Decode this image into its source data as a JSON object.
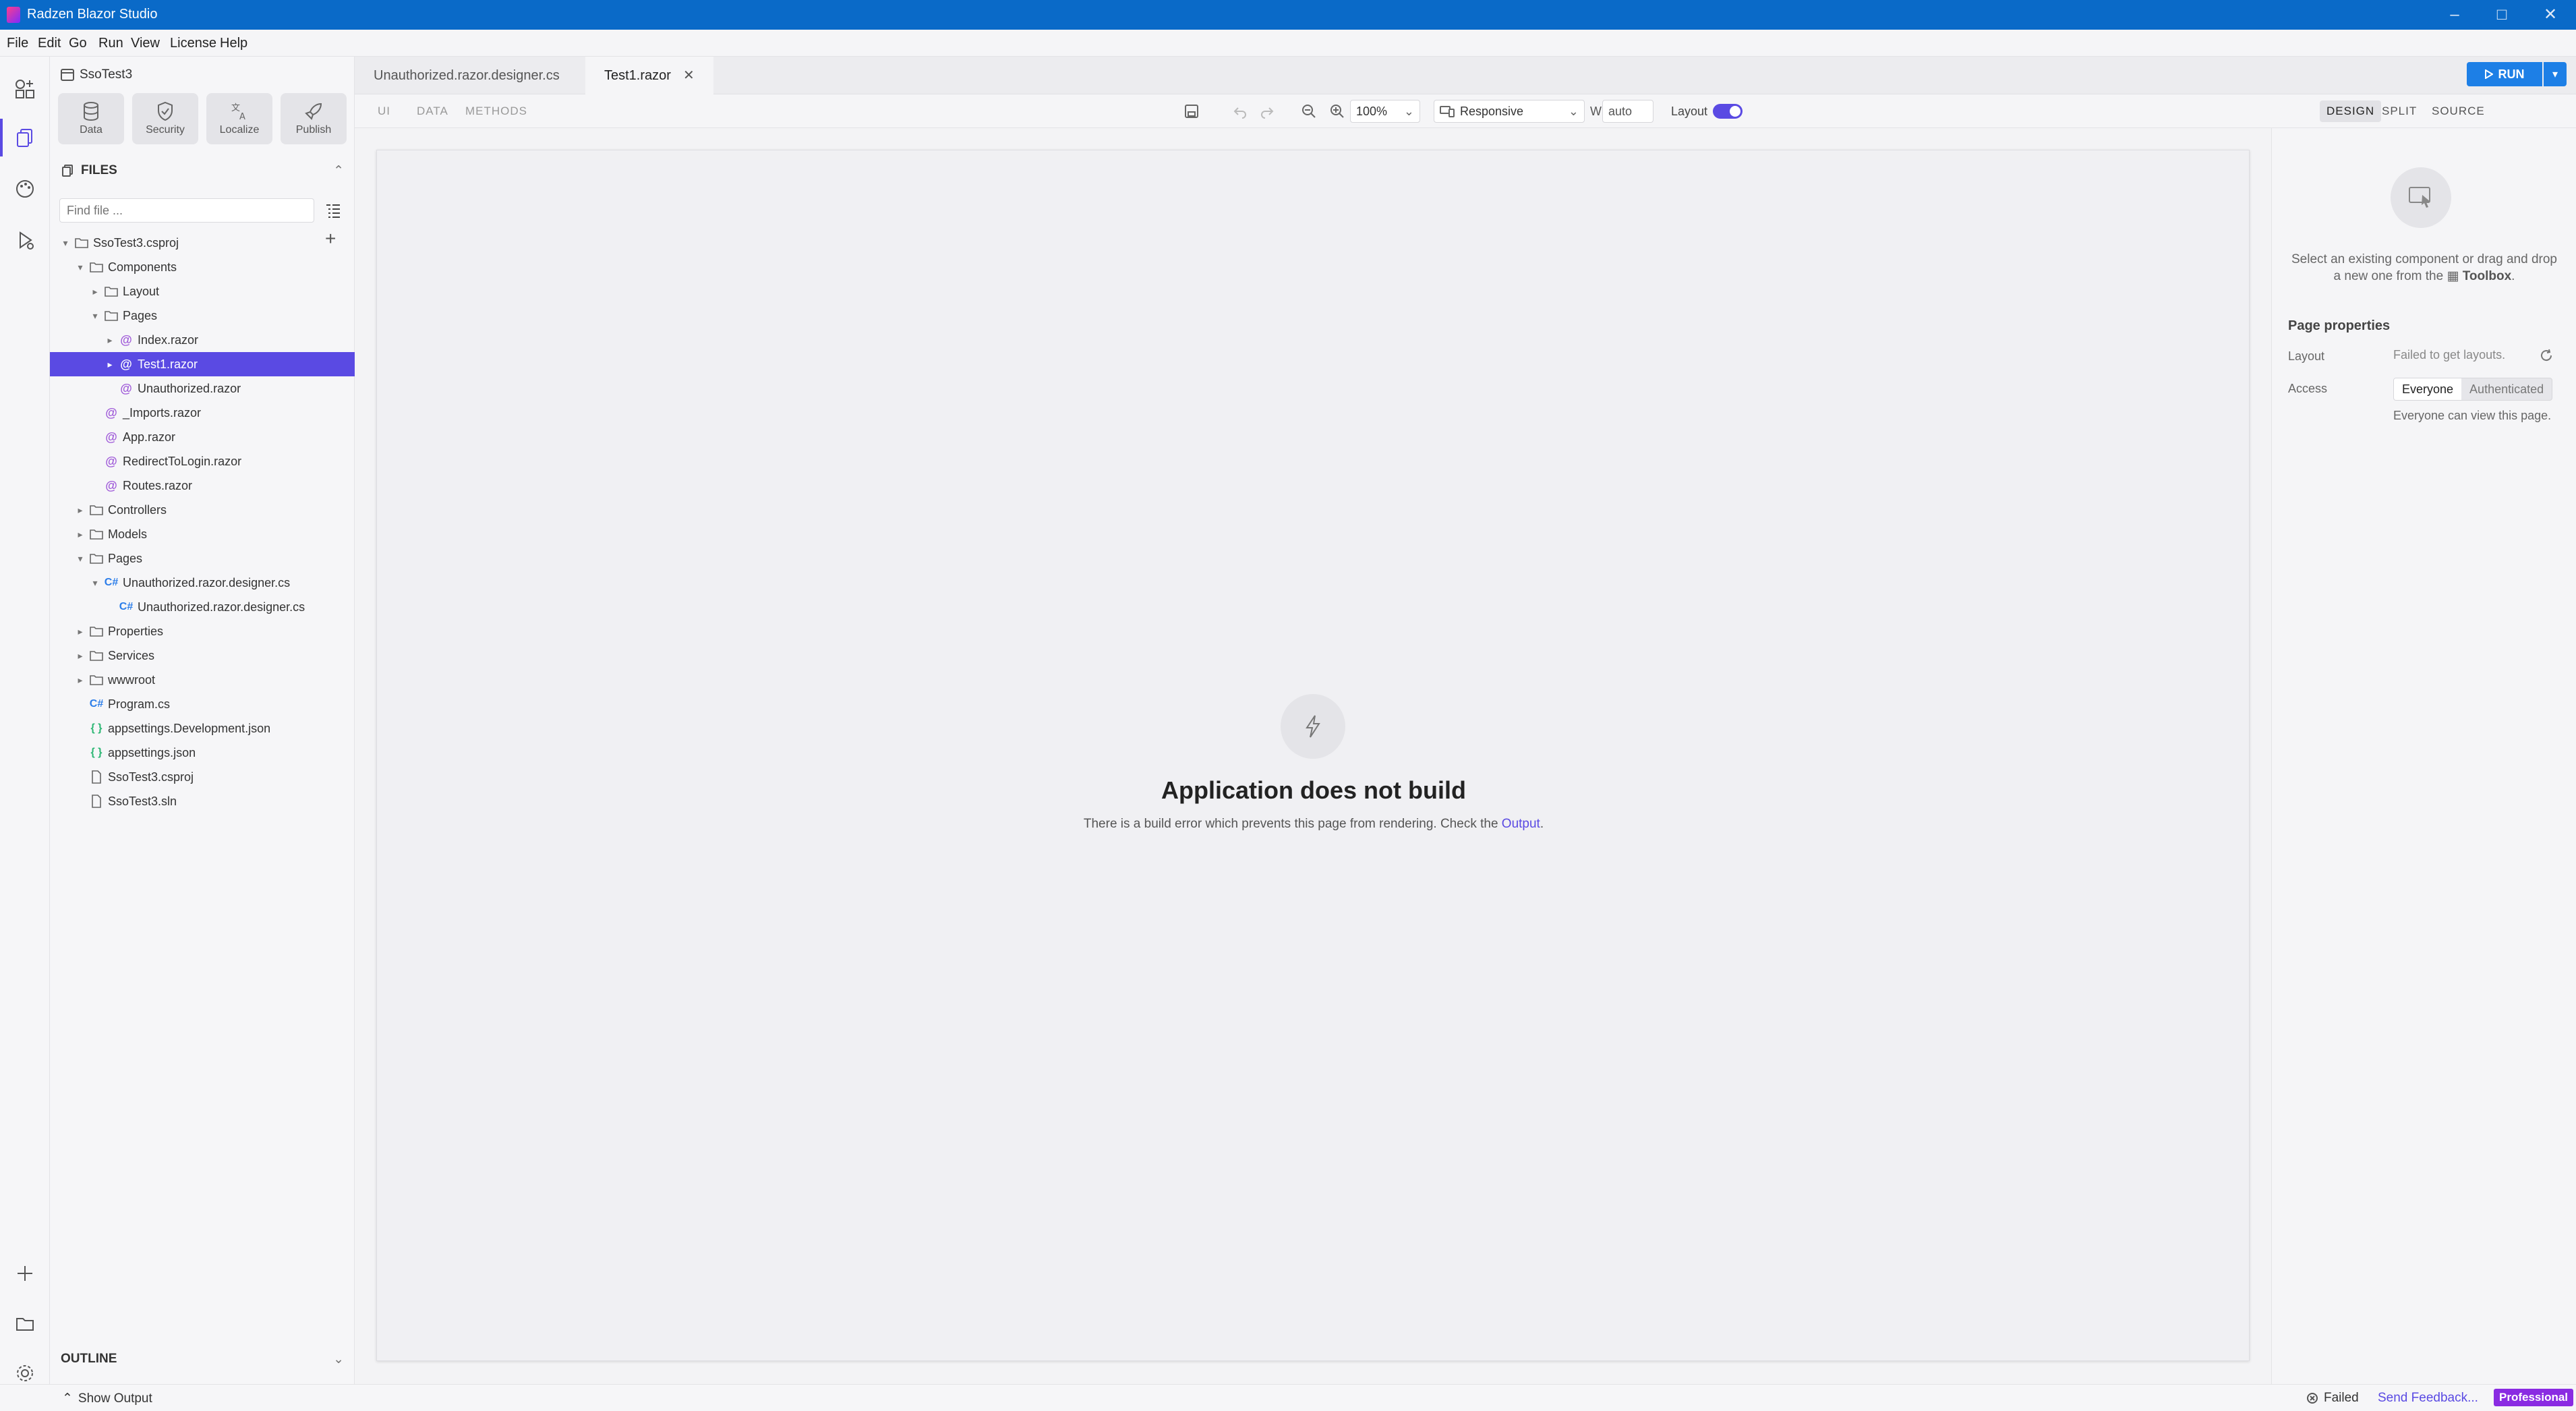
{
  "window": {
    "title": "Radzen Blazor Studio"
  },
  "menu": [
    "File",
    "Edit",
    "Go",
    "Run",
    "View",
    "License",
    "Help"
  ],
  "project": {
    "name": "SsoTest3"
  },
  "tools": [
    "Data",
    "Security",
    "Localize",
    "Publish"
  ],
  "files": {
    "header": "FILES",
    "find_placeholder": "Find file ...",
    "tree": [
      {
        "label": "SsoTest3.csproj",
        "icon": "folder-icon",
        "chev": "down",
        "level": 0
      },
      {
        "label": "Components",
        "icon": "folder-icon",
        "chev": "down",
        "level": 1
      },
      {
        "label": "Layout",
        "icon": "folder-icon",
        "chev": "right",
        "level": 2
      },
      {
        "label": "Pages",
        "icon": "folder-icon",
        "chev": "down",
        "level": 2
      },
      {
        "label": "Index.razor",
        "icon": "razor-icon",
        "chev": "right",
        "level": 3
      },
      {
        "label": "Test1.razor",
        "icon": "razor-icon",
        "chev": "right",
        "level": 3,
        "selected": true
      },
      {
        "label": "Unauthorized.razor",
        "icon": "razor-icon",
        "chev": "",
        "level": 3
      },
      {
        "label": "_Imports.razor",
        "icon": "razor-icon",
        "chev": "",
        "level": 2
      },
      {
        "label": "App.razor",
        "icon": "razor-icon",
        "chev": "",
        "level": 2
      },
      {
        "label": "RedirectToLogin.razor",
        "icon": "razor-icon",
        "chev": "",
        "level": 2
      },
      {
        "label": "Routes.razor",
        "icon": "razor-icon",
        "chev": "",
        "level": 2
      },
      {
        "label": "Controllers",
        "icon": "folder-icon",
        "chev": "right",
        "level": 1
      },
      {
        "label": "Models",
        "icon": "folder-icon",
        "chev": "right",
        "level": 1
      },
      {
        "label": "Pages",
        "icon": "folder-icon",
        "chev": "down",
        "level": 1
      },
      {
        "label": "Unauthorized.razor.designer.cs",
        "icon": "csharp-icon",
        "chev": "down",
        "level": 2
      },
      {
        "label": "Unauthorized.razor.designer.cs",
        "icon": "csharp-icon",
        "chev": "",
        "level": 3
      },
      {
        "label": "Properties",
        "icon": "folder-icon",
        "chev": "right",
        "level": 1
      },
      {
        "label": "Services",
        "icon": "folder-icon",
        "chev": "right",
        "level": 1
      },
      {
        "label": "wwwroot",
        "icon": "folder-icon",
        "chev": "right",
        "level": 1
      },
      {
        "label": "Program.cs",
        "icon": "csharp-icon",
        "chev": "",
        "level": 1
      },
      {
        "label": "appsettings.Development.json",
        "icon": "json-icon",
        "chev": "",
        "level": 1
      },
      {
        "label": "appsettings.json",
        "icon": "json-icon",
        "chev": "",
        "level": 1
      },
      {
        "label": "SsoTest3.csproj",
        "icon": "file-icon",
        "chev": "",
        "level": 1
      },
      {
        "label": "SsoTest3.sln",
        "icon": "file-icon",
        "chev": "",
        "level": 1
      }
    ]
  },
  "outline": {
    "header": "OUTLINE"
  },
  "tabs": [
    {
      "label": "Unauthorized.razor.designer.cs",
      "active": false
    },
    {
      "label": "Test1.razor",
      "active": true
    }
  ],
  "run": {
    "label": "RUN"
  },
  "toolbar": {
    "tabs": [
      "UI",
      "DATA",
      "METHODS"
    ],
    "zoom": "100%",
    "device": "Responsive",
    "width_label": "W",
    "width_value": "auto",
    "layout_label": "Layout",
    "layout_on": true,
    "view_modes": [
      "DESIGN",
      "SPLIT",
      "SOURCE"
    ],
    "active_view": "DESIGN"
  },
  "canvas": {
    "title": "Application does not build",
    "message": "There is a build error which prevents this page from rendering. Check the ",
    "link": "Output",
    "suffix": "."
  },
  "properties": {
    "hint_line1": "Select an existing component or drag and drop",
    "hint_line2": "a new one from the",
    "hint_toolbox": "Toolbox",
    "hint_end": ".",
    "title": "Page properties",
    "layout_label": "Layout",
    "layout_value": "Failed to get layouts.",
    "access_label": "Access",
    "access_options": [
      "Everyone",
      "Authenticated"
    ],
    "access_selected": "Everyone",
    "access_note": "Everyone can view this page."
  },
  "status": {
    "show_output": "Show Output",
    "build_status": "Failed",
    "feedback": "Send Feedback...",
    "edition": "Professional"
  },
  "colors": {
    "accent": "#5a4ae3",
    "titlebar": "#0a6ac8",
    "run": "#1d7fe6",
    "badge": "#8a2be2"
  }
}
